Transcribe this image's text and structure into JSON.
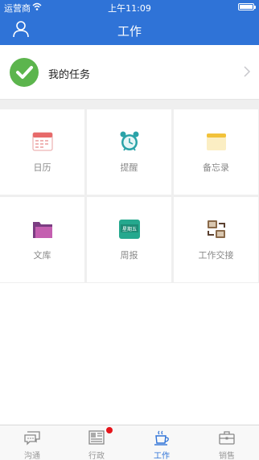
{
  "status": {
    "carrier": "运营商",
    "time": "上午11:09"
  },
  "nav": {
    "title": "工作"
  },
  "task": {
    "label": "我的任务"
  },
  "grid": [
    {
      "label": "日历",
      "icon": "calendar-icon"
    },
    {
      "label": "提醒",
      "icon": "alarm-clock-icon"
    },
    {
      "label": "备忘录",
      "icon": "notepad-icon"
    },
    {
      "label": "文库",
      "icon": "folder-icon"
    },
    {
      "label": "周报",
      "icon": "weekly-report-icon",
      "icon_text": "星期五"
    },
    {
      "label": "工作交接",
      "icon": "handover-icon"
    }
  ],
  "tabs": [
    {
      "label": "沟通",
      "icon": "chat-icon",
      "active": false,
      "badge": false
    },
    {
      "label": "行政",
      "icon": "newspaper-icon",
      "active": false,
      "badge": true
    },
    {
      "label": "工作",
      "icon": "coffee-cup-icon",
      "active": true,
      "badge": false
    },
    {
      "label": "销售",
      "icon": "briefcase-icon",
      "active": false,
      "badge": false
    }
  ],
  "colors": {
    "nav": "#2f73d7",
    "check": "#5cb54d",
    "badge": "#e5141b"
  }
}
